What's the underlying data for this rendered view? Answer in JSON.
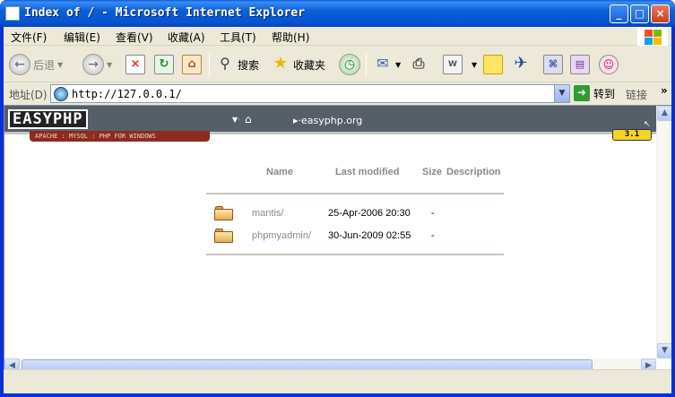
{
  "window": {
    "title": "Index of / - Microsoft Internet Explorer",
    "controls": {
      "minimize": "_",
      "maximize": "□",
      "close": "×"
    }
  },
  "menu": [
    {
      "label": "文件(F)"
    },
    {
      "label": "编辑(E)"
    },
    {
      "label": "查看(V)"
    },
    {
      "label": "收藏(A)"
    },
    {
      "label": "工具(T)"
    },
    {
      "label": "帮助(H)"
    }
  ],
  "toolbar": {
    "back_label": "后退",
    "search_label": "搜索",
    "favorites_label": "收藏夹"
  },
  "address": {
    "label": "地址(D)",
    "url": "http://127.0.0.1/",
    "go_label": "转到",
    "links_label": "链接",
    "links_chevron": "»"
  },
  "easyphp": {
    "logo": "EASYPHP",
    "tagline": "APACHE : MYSQL : PHP FOR WINDOWS",
    "nav_link": "easyphp.org",
    "version": "3.1"
  },
  "listing": {
    "headers": {
      "name": "Name",
      "last_modified": "Last modified",
      "size": "Size",
      "description": "Description"
    },
    "rows": [
      {
        "name": "mantis/",
        "last_modified": "25-Apr-2006 20:30",
        "size": "-"
      },
      {
        "name": "phpmyadmin/",
        "last_modified": "30-Jun-2009 02:55",
        "size": "-"
      }
    ]
  },
  "colors": {
    "title_blue": "#0a5fd8",
    "chrome": "#ece9d8",
    "easyphp_header": "#565f68",
    "easyphp_tag": "#8f2a1f",
    "version_badge": "#f5d228"
  }
}
